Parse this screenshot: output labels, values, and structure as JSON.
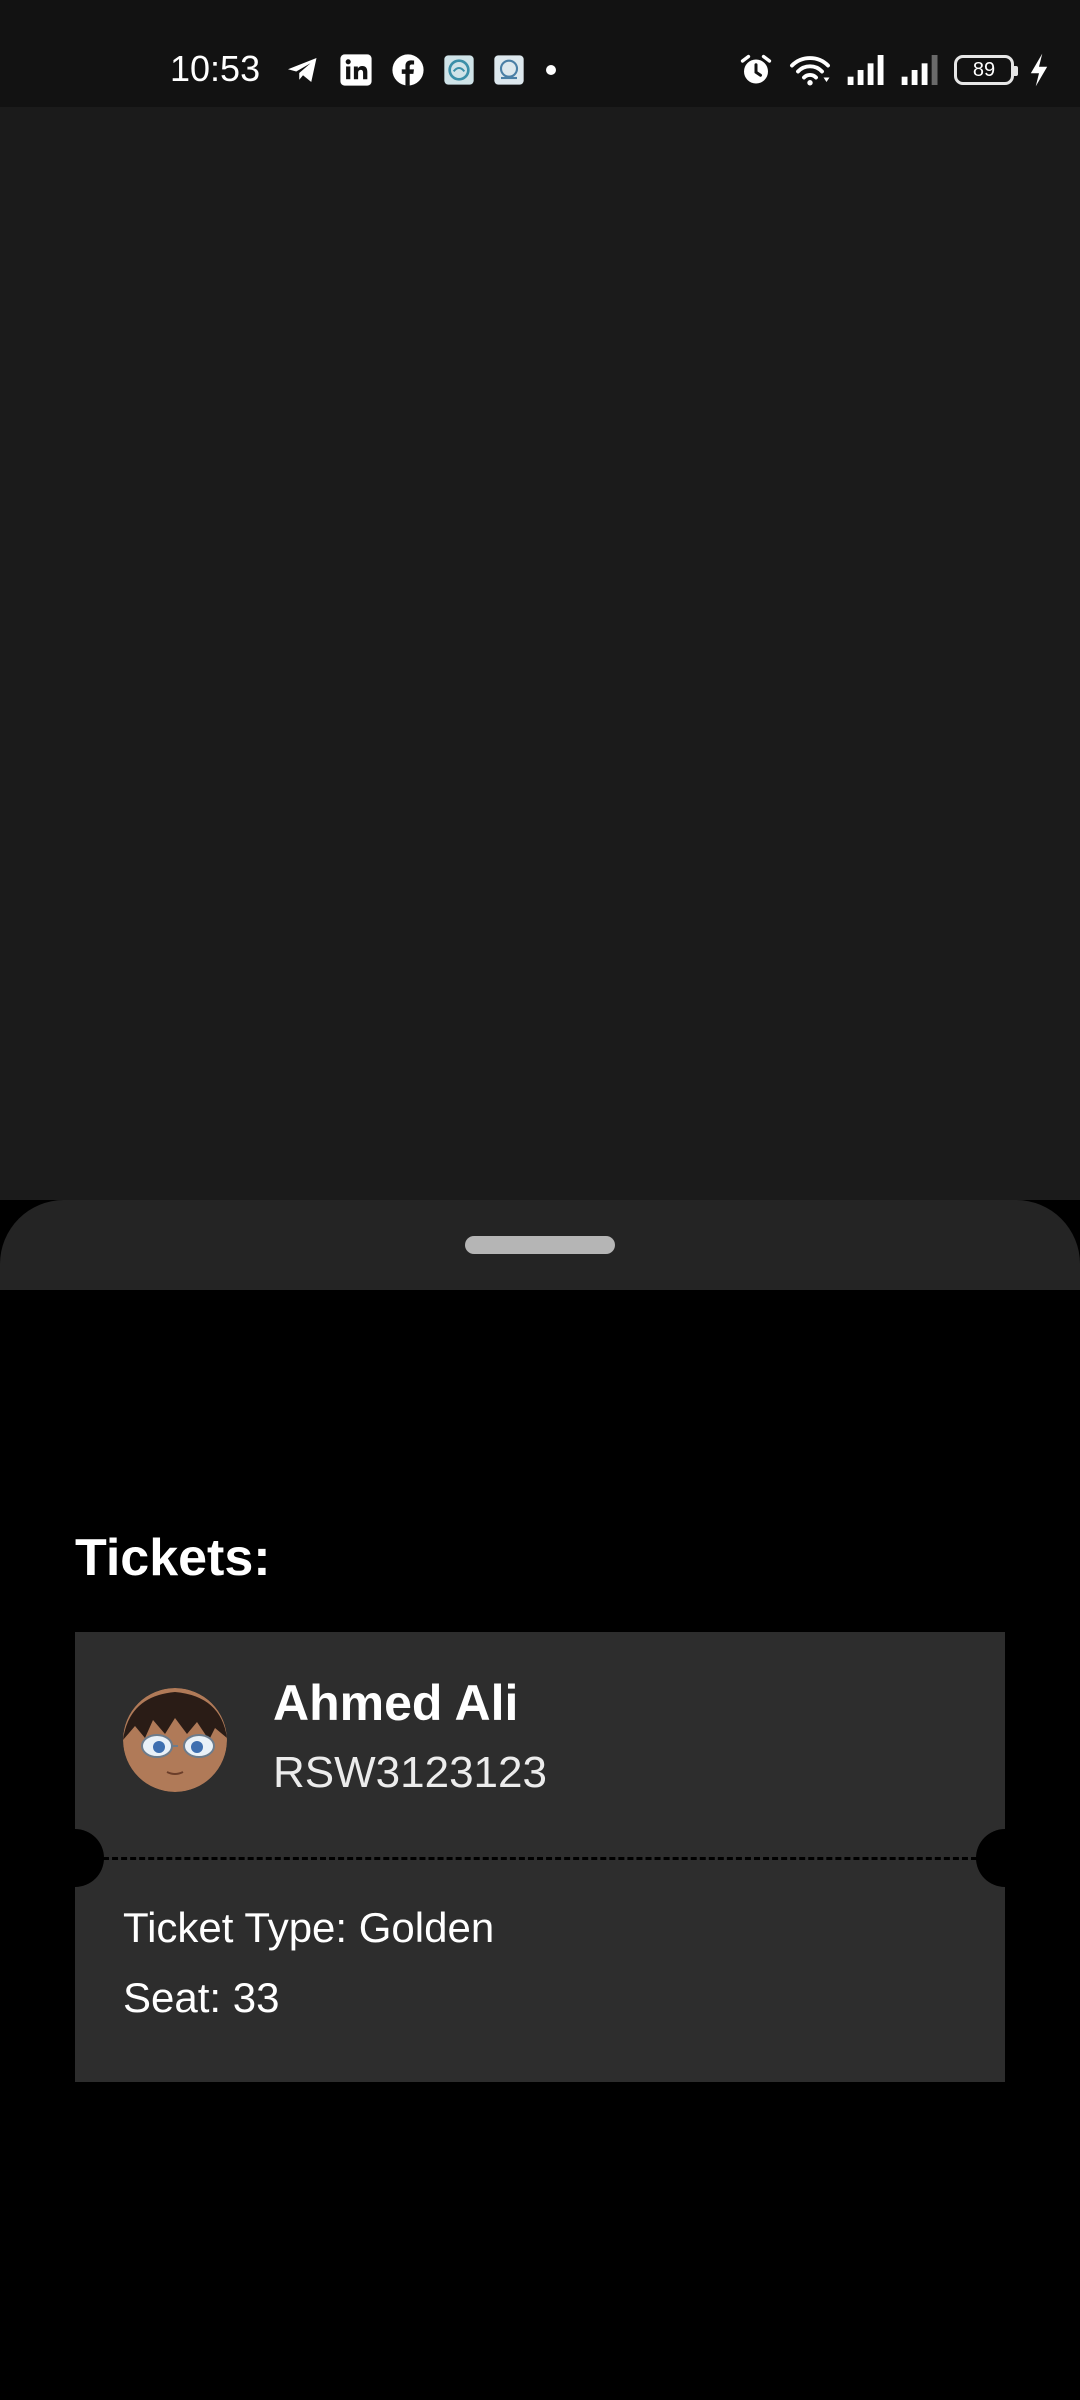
{
  "status_bar": {
    "time": "10:53",
    "left_icons": [
      "telegram-icon",
      "linkedin-icon",
      "facebook-icon",
      "app-icon-1",
      "app-icon-2",
      "notification-dot-icon"
    ],
    "right_icons": [
      "alarm-icon",
      "wifi-icon",
      "signal-icon",
      "signal-icon-2",
      "battery-icon",
      "charging-icon"
    ],
    "battery_level": "89"
  },
  "sheet": {
    "section_title": "Tickets:",
    "tickets": [
      {
        "holder_name": "Ahmed Ali",
        "code": "RSW3123123",
        "type_line": "Ticket Type: Golden",
        "seat_line": "Seat: 33"
      }
    ]
  },
  "colors": {
    "status_bar_bg": "#121212",
    "backdrop_bg": "#1b1b1b",
    "sheet_header_bg": "#242424",
    "sheet_bg": "#000000",
    "card_bg": "#2d2d2d",
    "handle": "#b5b5b5"
  }
}
